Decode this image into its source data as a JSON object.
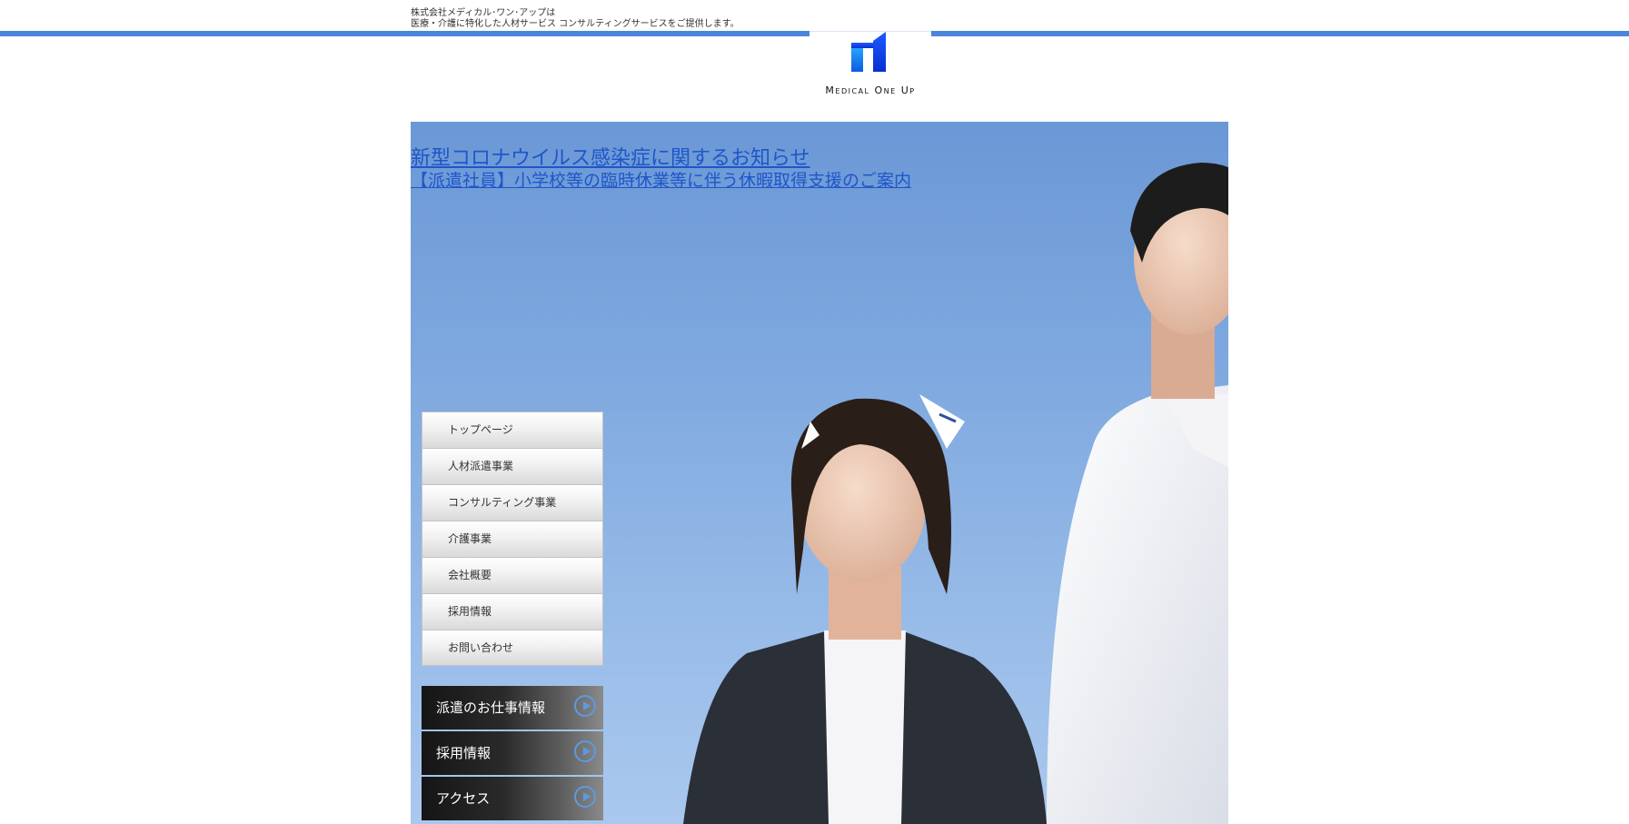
{
  "header": {
    "tagline_line1": "株式会社メディカル･ワン･アップは",
    "tagline_line2": "医療・介護に特化した人材サービス コンサルティングサービスをご提供します。",
    "logo_text": "Medical One Up",
    "accent_color": "#4a86db"
  },
  "notices": [
    {
      "text": "新型コロナウイルス感染症に関するお知らせ"
    },
    {
      "text": "【派遣社員】小学校等の臨時休業等に伴う休暇取得支援のご案内"
    }
  ],
  "menu": {
    "items": [
      {
        "label": "トップページ"
      },
      {
        "label": "人材派遣事業"
      },
      {
        "label": "コンサルティング事業"
      },
      {
        "label": "介護事業"
      },
      {
        "label": "会社概要"
      },
      {
        "label": "採用情報"
      },
      {
        "label": "お問い合わせ"
      }
    ]
  },
  "banners": [
    {
      "label": "派遣のお仕事情報",
      "icon": "play-circle-icon"
    },
    {
      "label": "採用情報",
      "icon": "play-circle-icon"
    },
    {
      "label": "アクセス",
      "icon": "play-circle-icon"
    }
  ],
  "hero": {
    "image": "nurse-and-doctor-photo"
  }
}
